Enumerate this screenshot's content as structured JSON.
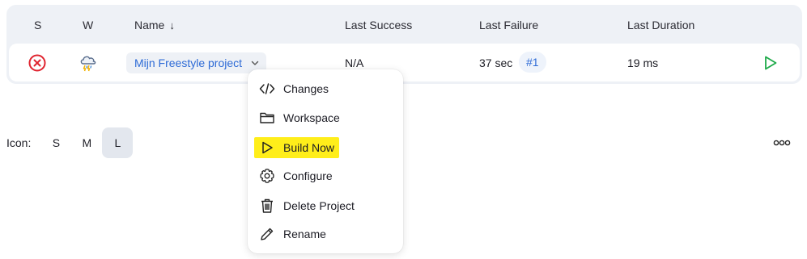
{
  "table": {
    "headers": {
      "status": "S",
      "weather": "W",
      "name": "Name",
      "sort_indicator": "↓",
      "last_success": "Last Success",
      "last_failure": "Last Failure",
      "last_duration": "Last Duration"
    },
    "rows": [
      {
        "status_icon": "failed-x-circle-icon",
        "weather_icon": "storm-cloud-icon",
        "name": "Mijn Freestyle project",
        "last_success": "N/A",
        "last_failure": "37 sec",
        "last_failure_build": "#1",
        "last_duration": "19 ms",
        "action_icon": "play-icon"
      }
    ]
  },
  "context_menu": {
    "items": [
      {
        "label": "Changes",
        "icon": "code-icon"
      },
      {
        "label": "Workspace",
        "icon": "folder-icon"
      },
      {
        "label": "Build Now",
        "icon": "play-icon",
        "highlighted": true
      },
      {
        "label": "Configure",
        "icon": "gear-icon"
      },
      {
        "label": "Delete Project",
        "icon": "trash-icon"
      },
      {
        "label": "Rename",
        "icon": "pencil-icon"
      }
    ]
  },
  "icon_size": {
    "label": "Icon:",
    "options": [
      "S",
      "M",
      "L"
    ],
    "selected": "L"
  },
  "colors": {
    "accent": "#2e6bd6",
    "failure": "#e0242f",
    "success_play": "#1faa4a",
    "highlight": "#ffee1a",
    "table_bg": "#eef1f6"
  }
}
